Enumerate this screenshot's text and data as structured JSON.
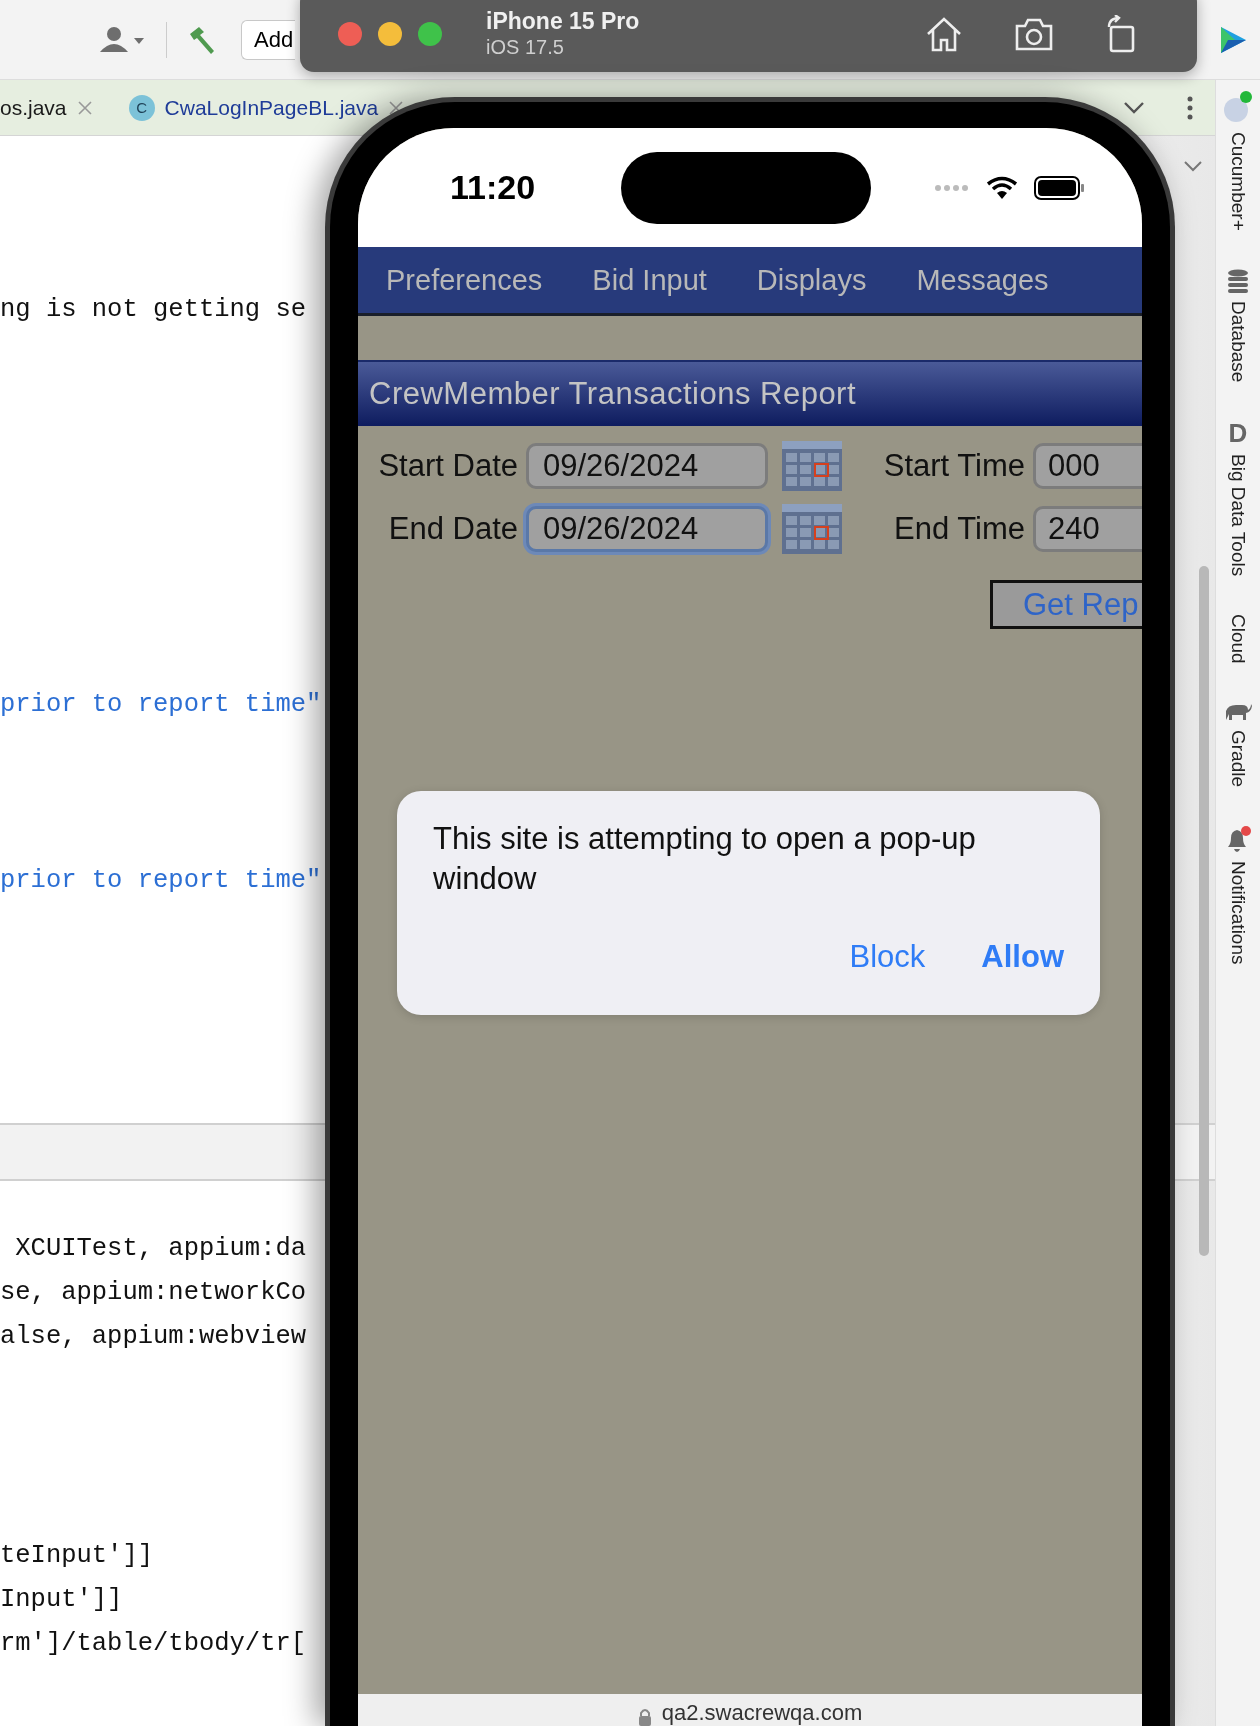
{
  "ide": {
    "toolbar": {
      "add_button": "Add"
    },
    "editor_tabs": [
      {
        "label": "os.java"
      },
      {
        "label": "CwaLogInPageBL.java",
        "icon_text": "C"
      }
    ],
    "code_lines": [
      {
        "text": "ng is not getting se",
        "kind": "plain"
      },
      {
        "text": "prior to report time\"",
        "kind": "string"
      },
      {
        "text": "prior to report time\"",
        "kind": "string"
      }
    ],
    "console_lines": [
      {
        "text": " XCUITest, appium:da"
      },
      {
        "text": "se, appium:networkCo"
      },
      {
        "text": "alse, appium:webview"
      },
      {
        "text": "teInput']]"
      },
      {
        "text": "Input']]"
      },
      {
        "text": "rm']/table/tbody/tr["
      }
    ],
    "sidebar": [
      {
        "label": "Cucumber+",
        "kind": "avatar"
      },
      {
        "label": "Database",
        "kind": "database"
      },
      {
        "label": "Big Data Tools",
        "kind": "letter",
        "icon_text": "D"
      },
      {
        "label": "Cloud",
        "kind": "none"
      },
      {
        "label": "Gradle",
        "kind": "elephant"
      },
      {
        "label": "Notifications",
        "kind": "bell"
      }
    ]
  },
  "simulator": {
    "title": "iPhone 15 Pro",
    "subtitle": "iOS 17.5"
  },
  "phone": {
    "time": "11:20",
    "nav": [
      "Preferences",
      "Bid Input",
      "Displays",
      "Messages"
    ],
    "report_title": "CrewMember Transactions Report",
    "rows": [
      {
        "date_label": "Start Date",
        "date_value": "09/26/2024",
        "focused": false,
        "time_label": "Start Time",
        "time_value": "000"
      },
      {
        "date_label": "End Date",
        "date_value": "09/26/2024",
        "focused": true,
        "time_label": "End Time",
        "time_value": "240"
      }
    ],
    "report_button": "Get Rep",
    "dialog": {
      "message": "This site is attempting to open a pop-up window",
      "buttons": [
        {
          "label": "Block",
          "primary": false
        },
        {
          "label": "Allow",
          "primary": true
        }
      ]
    },
    "url": "qa2.swacrewqa.com"
  }
}
